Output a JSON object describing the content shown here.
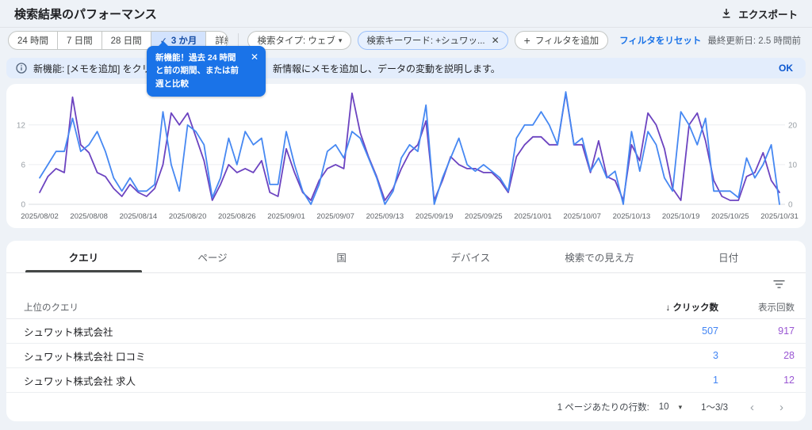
{
  "header": {
    "title": "検索結果のパフォーマンス",
    "export_label": "エクスポート"
  },
  "filters": {
    "date_ranges": [
      {
        "label": "24 時間",
        "selected": false
      },
      {
        "label": "7 日間",
        "selected": false
      },
      {
        "label": "28 日間",
        "selected": false
      },
      {
        "label": "3 か月",
        "selected": true
      }
    ],
    "detail_label": "詳細",
    "search_type_chip": "検索タイプ: ウェブ",
    "keyword_chip": "検索キーワード: +シュワッ...",
    "add_filter_label": "フィルタを追加",
    "reset_label": "フィルタをリセット",
    "last_updated": "最終更新日: 2.5 時間前"
  },
  "tooltip": {
    "text": "新機能！過去 24 時間と前の期間、または前週と比較",
    "close": "✕"
  },
  "banner": {
    "text_left": "新機能: [メモを追加] をクリックするか",
    "text_right": "新情報にメモを追加し、データの変動を説明します。",
    "ok_label": "OK"
  },
  "chart_data": {
    "type": "line",
    "granularity": "daily",
    "start_date": "2025/08/02",
    "end_date": "2025/10/31",
    "tick_labels": [
      "2025/08/02",
      "2025/08/08",
      "2025/08/14",
      "2025/08/20",
      "2025/08/26",
      "2025/09/01",
      "2025/09/07",
      "2025/09/13",
      "2025/09/19",
      "2025/09/25",
      "2025/10/01",
      "2025/10/07",
      "2025/10/13",
      "2025/10/19",
      "2025/10/25",
      "2025/10/31"
    ],
    "left_axis": {
      "ticks": [
        0,
        6,
        12
      ],
      "max": 17,
      "series": "クリック数"
    },
    "right_axis": {
      "ticks": [
        0,
        10,
        20
      ],
      "max": 28.33,
      "series": "表示回数"
    },
    "grid": true,
    "series": [
      {
        "name": "クリック数",
        "axis": "left",
        "color": "#4688f2",
        "values": [
          4,
          6,
          8,
          8,
          13,
          8,
          9,
          11,
          8,
          4,
          2,
          4,
          2,
          2,
          3,
          14,
          6,
          2,
          12,
          11,
          9,
          1,
          4,
          10,
          6,
          11,
          9,
          10,
          3,
          3,
          11,
          6,
          2,
          0,
          3,
          8,
          9,
          7,
          11,
          10,
          7,
          4,
          0,
          2,
          7,
          9,
          8,
          15,
          0,
          4,
          7,
          10,
          6,
          5,
          6,
          5,
          4,
          2,
          10,
          12,
          12,
          14,
          12,
          9,
          17,
          9,
          10,
          5,
          7,
          4,
          5,
          0,
          11,
          5,
          11,
          9,
          4,
          2,
          14,
          12,
          9,
          13,
          2,
          2,
          2,
          1,
          7,
          4,
          6,
          9,
          0
        ]
      },
      {
        "name": "表示回数",
        "axis": "right",
        "color": "#6c43c0",
        "values": [
          3,
          7,
          9,
          8,
          27,
          15,
          13,
          8,
          7,
          4,
          2,
          5,
          3,
          2,
          4,
          10,
          23,
          20,
          23,
          17,
          11,
          1,
          5,
          10,
          8,
          9,
          8,
          11,
          3,
          2,
          14,
          8,
          3,
          1,
          6,
          9,
          10,
          9,
          28,
          18,
          12,
          7,
          1,
          4,
          9,
          13,
          15,
          21,
          1,
          6,
          12,
          10,
          9,
          9,
          8,
          8,
          6,
          3,
          12,
          15,
          17,
          17,
          15,
          15,
          28,
          15,
          15,
          8,
          16,
          7,
          6,
          1,
          15,
          11,
          23,
          20,
          14,
          4,
          1,
          20,
          23,
          16,
          6,
          2,
          1,
          1,
          7,
          8,
          13,
          6,
          3
        ]
      }
    ]
  },
  "table": {
    "tabs": [
      {
        "label": "クエリ",
        "active": true
      },
      {
        "label": "ページ",
        "active": false
      },
      {
        "label": "国",
        "active": false
      },
      {
        "label": "デバイス",
        "active": false
      },
      {
        "label": "検索での見え方",
        "active": false
      },
      {
        "label": "日付",
        "active": false
      }
    ],
    "headers": {
      "query": "上位のクエリ",
      "clicks": "クリック数",
      "impressions": "表示回数",
      "sort_arrow": "↓"
    },
    "rows": [
      {
        "query": "シュワット株式会社",
        "clicks": "507",
        "impressions": "917"
      },
      {
        "query": "シュワット株式会社 口コミ",
        "clicks": "3",
        "impressions": "28"
      },
      {
        "query": "シュワット株式会社 求人",
        "clicks": "1",
        "impressions": "12"
      }
    ]
  },
  "pagination": {
    "rows_per_page_label": "1 ページあたりの行数:",
    "rows_per_page_value": "10",
    "range": "1～3/3",
    "prev": "‹",
    "next": "›"
  },
  "colors": {
    "accent_blue": "#1a73e8",
    "clicks_line": "#4688f2",
    "impressions_line": "#6c43c0",
    "clicks_value": "#4285f4",
    "impressions_value": "#9a57d3",
    "selected_segment_bg": "#d3e3fd",
    "banner_bg": "#e3edfc",
    "tooltip_bg": "#1a73e8"
  }
}
